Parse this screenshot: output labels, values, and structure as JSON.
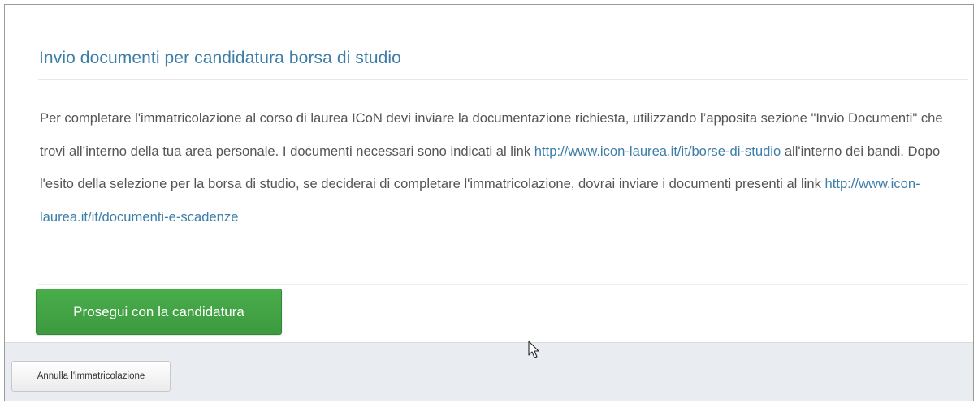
{
  "panel": {
    "title": "Invio documenti per candidatura borsa di studio",
    "body": {
      "text_1": "Per completare l'immatricolazione al corso di laurea ICoN devi inviare la documentazione richiesta, utilizzando l’apposita sezione \"Invio Documenti\" che trovi all’interno della tua area personale. I documenti necessari sono indicati al link ",
      "link_1": "http://www.icon-laurea.it/it/borse-di-studio",
      "text_2": " all'interno dei bandi. Dopo l'esito della selezione per la borsa di studio, se deciderai di completare l'immatricolazione, dovrai inviare i documenti presenti al link ",
      "link_2": "http://www.icon-laurea.it/it/documenti-e-scadenze"
    },
    "primary_button_label": "Prosegui con la candidatura"
  },
  "footer": {
    "cancel_button_label": "Annulla l'immatricolazione"
  },
  "icons": {
    "cursor": "mouse-pointer-icon"
  },
  "colors": {
    "title": "#3d7ea8",
    "link": "#3d7ea8",
    "primary_button": "#45a647",
    "footer_band": "#e9edf1"
  }
}
